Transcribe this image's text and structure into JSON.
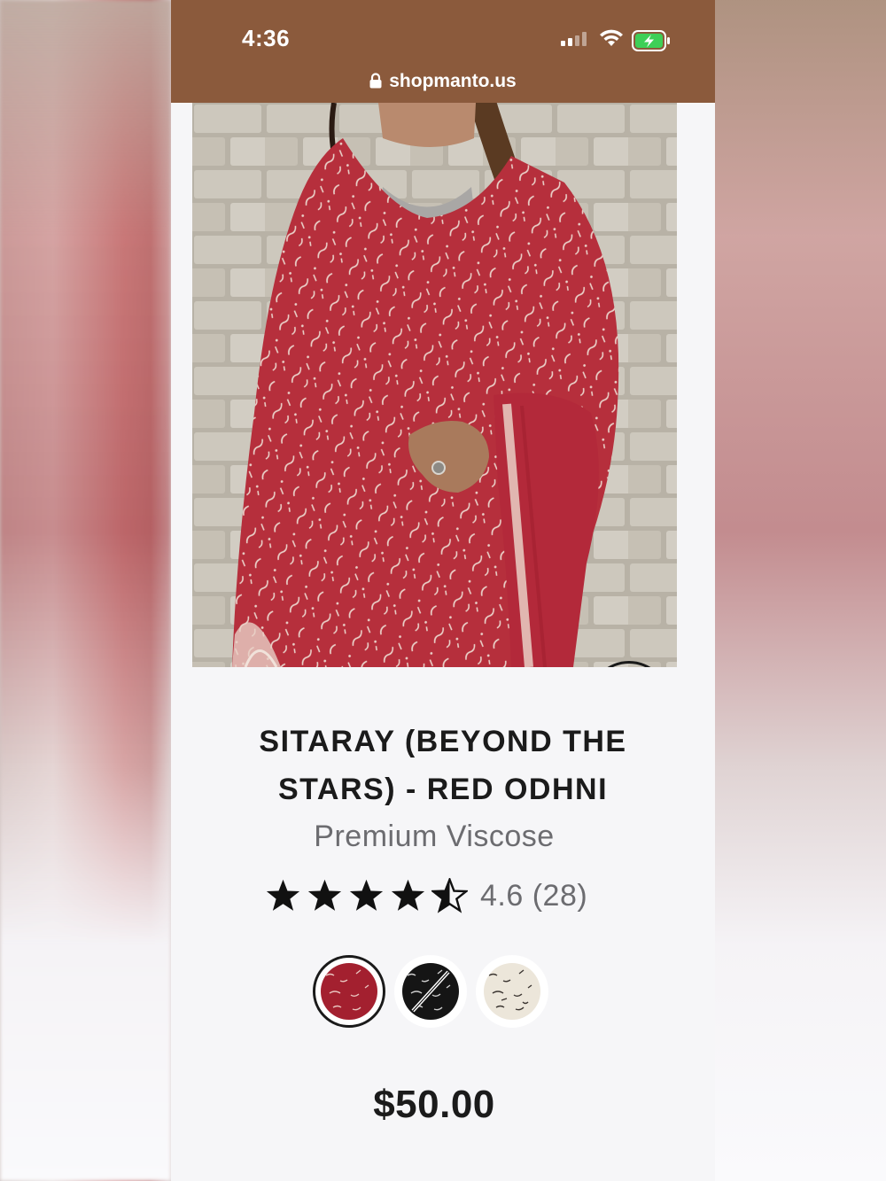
{
  "status_bar": {
    "time": "4:36",
    "signal_icon": "signal-icon",
    "wifi_icon": "wifi-icon",
    "battery_icon": "battery-charging-icon",
    "background_color": "#8b5a3c"
  },
  "address_bar": {
    "lock_icon": "lock-icon",
    "url": "shopmanto.us"
  },
  "product": {
    "image_description": "woman wearing red odhni with white calligraphy print against stone wall",
    "title": "SITARAY (BEYOND THE STARS) - RED ODHNI",
    "material": "Premium Viscose",
    "rating": {
      "value": 4.6,
      "max": 5,
      "text": "4.6 (28)"
    },
    "add_to_bag_icon": "shopping-bag-icon",
    "swatches": [
      {
        "name": "red",
        "color": "#a3202f",
        "selected": true,
        "available": true
      },
      {
        "name": "black",
        "color": "#151515",
        "selected": false,
        "available": false
      },
      {
        "name": "ivory",
        "color": "#ece6da",
        "selected": false,
        "available": true
      }
    ],
    "price": "$50.00"
  },
  "colors": {
    "fabric_red": "#b5303d",
    "text_dark": "#1b1b1b",
    "text_muted": "#6c6c70",
    "page_bg": "#f6f6f8"
  }
}
